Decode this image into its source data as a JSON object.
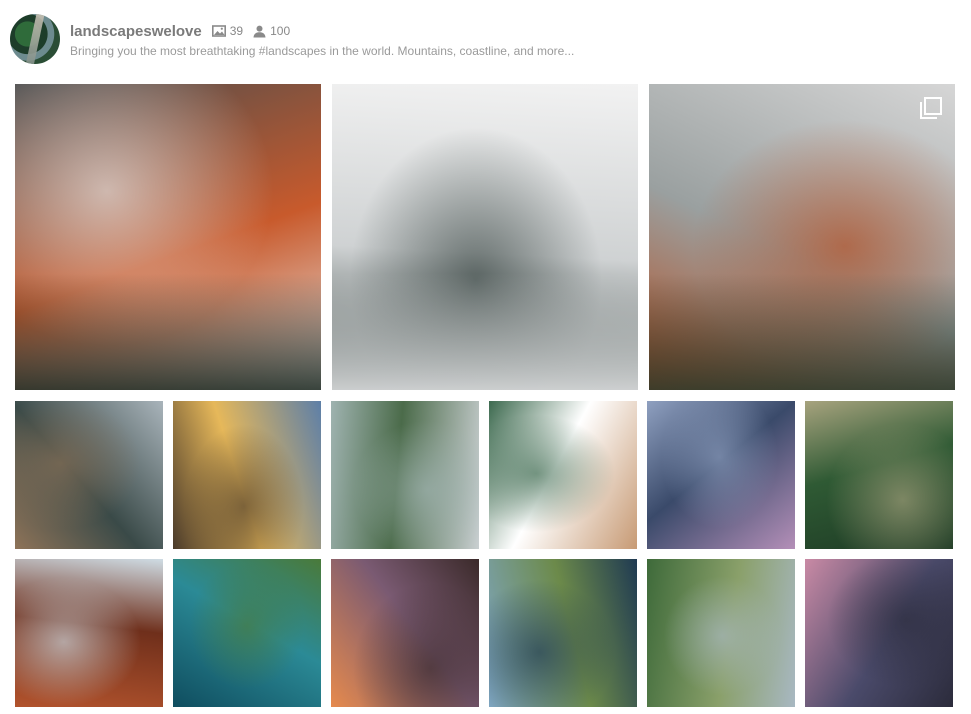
{
  "profile": {
    "username": "landscapeswelove",
    "posts_count": "39",
    "followers_count": "100",
    "bio": "Bringing you the most breathtaking #landscapes in the world. Mountains, coastline, and more...",
    "icons": {
      "posts": "image-icon",
      "followers": "user-icon"
    }
  },
  "gallery": {
    "large_posts": [
      {
        "subject": "snowy orange cliffs",
        "colors": [
          "#4d4d4d",
          "#c85a2c",
          "#e9e9e9",
          "#1e2a22"
        ]
      },
      {
        "subject": "foggy forest valley above clouds",
        "colors": [
          "#f2f2f2",
          "#cfd2d3",
          "#2e3b38",
          "#e3e4e5"
        ]
      },
      {
        "subject": "misty forest with autumn trees",
        "colors": [
          "#d6d6d6",
          "#9aa0a0",
          "#b54b1e",
          "#2b3a2c"
        ],
        "multi_image": true,
        "multi_icon": "multiple-images-icon"
      }
    ],
    "small_posts": [
      {
        "subject": "cloudy mountain meadow",
        "colors": [
          "#a9b4bb",
          "#3a4a48",
          "#8e7358"
        ]
      },
      {
        "subject": "sunset over clouds and hills",
        "colors": [
          "#5d7fa8",
          "#e6b85a",
          "#4a3a2a"
        ]
      },
      {
        "subject": "river through green hills",
        "colors": [
          "#c9cfd1",
          "#4b6b4a",
          "#9fb3b0"
        ]
      },
      {
        "subject": "aerial beach and waves",
        "colors": [
          "#c79a74",
          "#ffffff",
          "#3d6a4f"
        ]
      },
      {
        "subject": "volcano above purple clouds",
        "colors": [
          "#b48fb8",
          "#3a4a6a",
          "#8fa0c0"
        ]
      },
      {
        "subject": "aerial dense forest",
        "colors": [
          "#1d3a24",
          "#2f5a34",
          "#a7a37e"
        ]
      },
      {
        "subject": "red canyon walls",
        "colors": [
          "#b2532d",
          "#6f2f1b",
          "#cfdce4"
        ]
      },
      {
        "subject": "aerial turquoise coastline",
        "colors": [
          "#0f4d5f",
          "#2b8a96",
          "#4a7a3a"
        ]
      },
      {
        "subject": "orange sunset beach",
        "colors": [
          "#e68a4d",
          "#7a5a72",
          "#3b2a2a"
        ]
      },
      {
        "subject": "sea cliffs coastline",
        "colors": [
          "#7fa6c2",
          "#6c8a4a",
          "#1f3a52"
        ]
      },
      {
        "subject": "green valley with river",
        "colors": [
          "#3e6a3a",
          "#8aa06a",
          "#a8b8c2"
        ]
      },
      {
        "subject": "pink sunset rocky shore",
        "colors": [
          "#c98aa5",
          "#4a4a6a",
          "#2b2b3b"
        ]
      }
    ]
  }
}
